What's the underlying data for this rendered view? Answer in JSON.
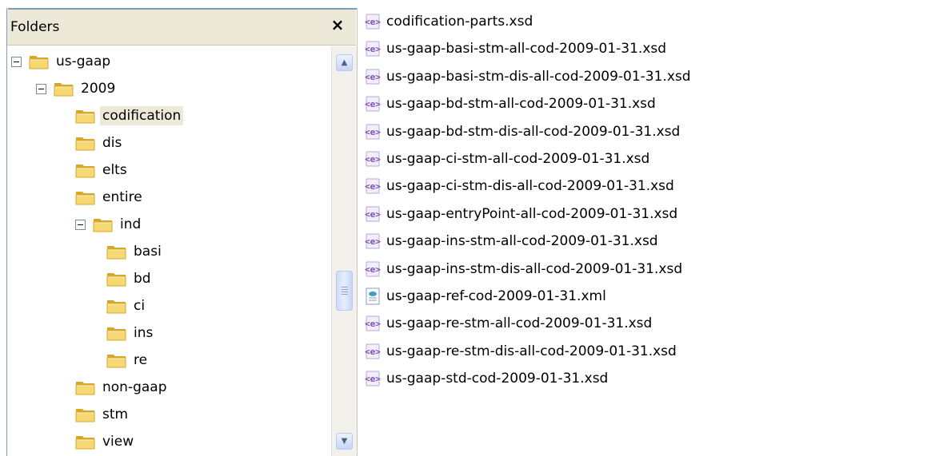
{
  "folders_pane": {
    "title": "Folders",
    "close_label": "×",
    "tree": [
      {
        "label": "us-gaap",
        "level": 0,
        "expanded": true
      },
      {
        "label": "2009",
        "level": 1,
        "expanded": true
      },
      {
        "label": "codification",
        "level": 2,
        "selected": true
      },
      {
        "label": "dis",
        "level": 2
      },
      {
        "label": "elts",
        "level": 2
      },
      {
        "label": "entire",
        "level": 2
      },
      {
        "label": "ind",
        "level": 2,
        "expanded": true
      },
      {
        "label": "basi",
        "level": 3
      },
      {
        "label": "bd",
        "level": 3
      },
      {
        "label": "ci",
        "level": 3
      },
      {
        "label": "ins",
        "level": 3
      },
      {
        "label": "re",
        "level": 3
      },
      {
        "label": "non-gaap",
        "level": 2
      },
      {
        "label": "stm",
        "level": 2
      },
      {
        "label": "view",
        "level": 2
      }
    ],
    "scroll_position": 0.62
  },
  "files": [
    {
      "name": "codification-parts.xsd",
      "icon": "xsd-file-icon"
    },
    {
      "name": "us-gaap-basi-stm-all-cod-2009-01-31.xsd",
      "icon": "xsd-file-icon"
    },
    {
      "name": "us-gaap-basi-stm-dis-all-cod-2009-01-31.xsd",
      "icon": "xsd-file-icon"
    },
    {
      "name": "us-gaap-bd-stm-all-cod-2009-01-31.xsd",
      "icon": "xsd-file-icon"
    },
    {
      "name": "us-gaap-bd-stm-dis-all-cod-2009-01-31.xsd",
      "icon": "xsd-file-icon"
    },
    {
      "name": "us-gaap-ci-stm-all-cod-2009-01-31.xsd",
      "icon": "xsd-file-icon"
    },
    {
      "name": "us-gaap-ci-stm-dis-all-cod-2009-01-31.xsd",
      "icon": "xsd-file-icon"
    },
    {
      "name": "us-gaap-entryPoint-all-cod-2009-01-31.xsd",
      "icon": "xsd-file-icon"
    },
    {
      "name": "us-gaap-ins-stm-all-cod-2009-01-31.xsd",
      "icon": "xsd-file-icon"
    },
    {
      "name": "us-gaap-ins-stm-dis-all-cod-2009-01-31.xsd",
      "icon": "xsd-file-icon"
    },
    {
      "name": "us-gaap-ref-cod-2009-01-31.xml",
      "icon": "xml-file-icon"
    },
    {
      "name": "us-gaap-re-stm-all-cod-2009-01-31.xsd",
      "icon": "xsd-file-icon"
    },
    {
      "name": "us-gaap-re-stm-dis-all-cod-2009-01-31.xsd",
      "icon": "xsd-file-icon"
    },
    {
      "name": "us-gaap-std-cod-2009-01-31.xsd",
      "icon": "xsd-file-icon"
    }
  ],
  "colors": {
    "folder_fill": "#f6d874",
    "folder_dark": "#d7a72c",
    "header_bg": "#ece9d8",
    "selection_bg": "#ece9d8",
    "xsd_icon": "#7b4fb5",
    "xml_icon": "#3aa0c8"
  }
}
